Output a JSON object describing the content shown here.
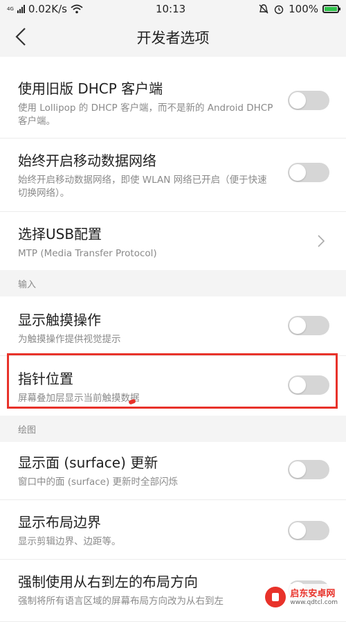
{
  "status_bar": {
    "network": "4G",
    "speed": "0.02K/s",
    "time": "10:13",
    "battery": "100%",
    "battery_level": 1.0
  },
  "header": {
    "title": "开发者选项",
    "back_icon": "chevron-left-icon"
  },
  "items": [
    {
      "title": "使用旧版 DHCP 客户端",
      "subtitle": "使用 Lollipop 的 DHCP 客户端，而不是新的 Android DHCP 客户端。",
      "toggle": false
    },
    {
      "title": "始终开启移动数据网络",
      "subtitle": "始终开启移动数据网络，即使 WLAN 网络已开启（便于快速切换网络）。",
      "toggle": false
    },
    {
      "title": "选择USB配置",
      "subtitle": "MTP (Media Transfer Protocol)",
      "chevron": true
    },
    {
      "section": "输入"
    },
    {
      "title": "显示触摸操作",
      "subtitle": "为触摸操作提供视觉提示",
      "toggle": false
    },
    {
      "title": "指针位置",
      "subtitle": "屏幕叠加层显示当前触摸数据",
      "toggle": false
    },
    {
      "section": "绘图"
    },
    {
      "title": "显示面 (surface) 更新",
      "subtitle": "窗口中的面 (surface) 更新时全部闪烁",
      "toggle": false
    },
    {
      "title": "显示布局边界",
      "subtitle": "显示剪辑边界、边距等。",
      "toggle": false
    },
    {
      "title": "强制使用从右到左的布局方向",
      "subtitle": "强制将所有语言区域的屏幕布局方向改为从右到左",
      "toggle": false
    }
  ],
  "watermark": {
    "name": "启东安卓网",
    "url": "www.qdtcl.com"
  },
  "colors": {
    "highlight": "#e8322a",
    "toggle_off": "#d6d6d6",
    "battery": "#2ec14a"
  }
}
